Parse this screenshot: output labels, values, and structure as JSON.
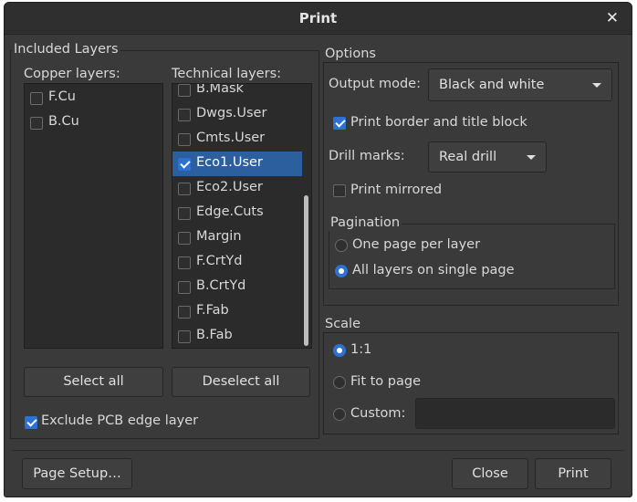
{
  "window": {
    "title": "Print"
  },
  "included_layers": {
    "title": "Included Layers",
    "copper": {
      "label": "Copper layers:",
      "items": [
        {
          "label": "F.Cu",
          "checked": false
        },
        {
          "label": "B.Cu",
          "checked": false
        }
      ]
    },
    "technical": {
      "label": "Technical layers:",
      "items": [
        {
          "label": "B.Mask",
          "checked": false
        },
        {
          "label": "Dwgs.User",
          "checked": false
        },
        {
          "label": "Cmts.User",
          "checked": false
        },
        {
          "label": "Eco1.User",
          "checked": true,
          "selected": true
        },
        {
          "label": "Eco2.User",
          "checked": false
        },
        {
          "label": "Edge.Cuts",
          "checked": false
        },
        {
          "label": "Margin",
          "checked": false
        },
        {
          "label": "F.CrtYd",
          "checked": false
        },
        {
          "label": "B.CrtYd",
          "checked": false
        },
        {
          "label": "F.Fab",
          "checked": false
        },
        {
          "label": "B.Fab",
          "checked": false
        }
      ]
    },
    "select_all": "Select all",
    "deselect_all": "Deselect all",
    "exclude_edge": {
      "label": "Exclude PCB edge layer",
      "checked": true
    }
  },
  "options": {
    "title": "Options",
    "output_mode": {
      "label": "Output mode:",
      "value": "Black and white"
    },
    "print_border": {
      "label": "Print border and title block",
      "checked": true
    },
    "drill_marks": {
      "label": "Drill marks:",
      "value": "Real drill"
    },
    "print_mirrored": {
      "label": "Print mirrored",
      "checked": false
    },
    "pagination": {
      "title": "Pagination",
      "one_page": {
        "label": "One page per layer",
        "checked": false
      },
      "all_layers": {
        "label": "All layers on single page",
        "checked": true
      }
    }
  },
  "scale": {
    "title": "Scale",
    "one_to_one": {
      "label": "1:1",
      "checked": true
    },
    "fit_to_page": {
      "label": "Fit to page",
      "checked": false
    },
    "custom": {
      "label": "Custom:",
      "checked": false,
      "value": ""
    }
  },
  "footer": {
    "page_setup": "Page Setup…",
    "close": "Close",
    "print": "Print"
  },
  "colors": {
    "accent": "#2d72d2",
    "selection": "#2c5f9e",
    "background": "#3a3a3a"
  }
}
